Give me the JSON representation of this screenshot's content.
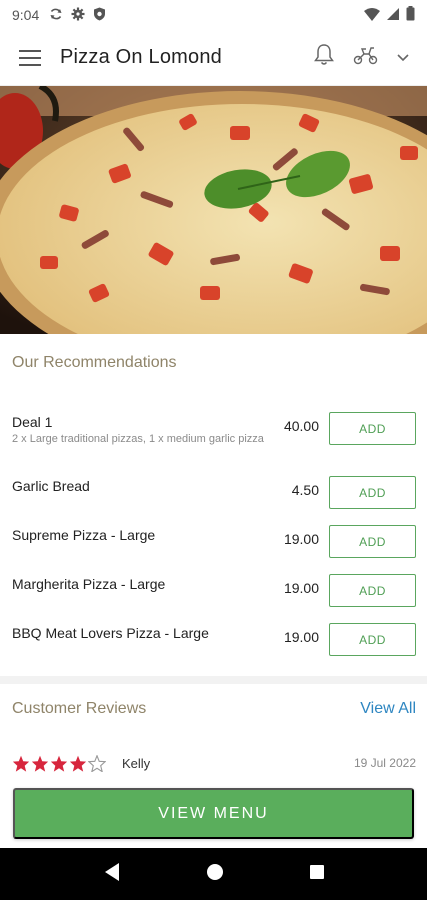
{
  "status_bar": {
    "time": "9:04",
    "left_icons": [
      "sync-icon",
      "gear-icon",
      "shield-icon"
    ],
    "right_icons": [
      "wifi-icon",
      "signal-icon",
      "battery-icon"
    ]
  },
  "app_bar": {
    "title": "Pizza On Lomond",
    "icons": [
      "menu-icon",
      "bell-icon",
      "scooter-icon",
      "chevron-down-icon"
    ]
  },
  "hero": {
    "image": "pizza-photo"
  },
  "recommendations": {
    "title": "Our Recommendations",
    "add_label": "ADD",
    "items": [
      {
        "name": "Deal 1",
        "description": "2 x Large traditional pizzas, 1 x medium garlic pizza",
        "price": "40.00"
      },
      {
        "name": "Garlic Bread",
        "description": "",
        "price": "4.50"
      },
      {
        "name": "Supreme Pizza - Large",
        "description": "",
        "price": "19.00"
      },
      {
        "name": "Margherita Pizza - Large",
        "description": "",
        "price": "19.00"
      },
      {
        "name": "BBQ Meat Lovers Pizza - Large",
        "description": "",
        "price": "19.00"
      }
    ]
  },
  "reviews": {
    "title": "Customer Reviews",
    "view_all": "View All",
    "items": [
      {
        "rating": 4,
        "max_rating": 5,
        "name": "Kelly",
        "date": "19 Jul 2022"
      }
    ]
  },
  "view_menu_label": "VIEW MENU",
  "nav_bar": {
    "icons": [
      "back-icon",
      "home-icon",
      "recents-icon"
    ]
  },
  "colors": {
    "accent_green": "#5aae5c",
    "section_title": "#8f8469",
    "link_blue": "#2e86c1",
    "star_red": "#d7263d"
  }
}
